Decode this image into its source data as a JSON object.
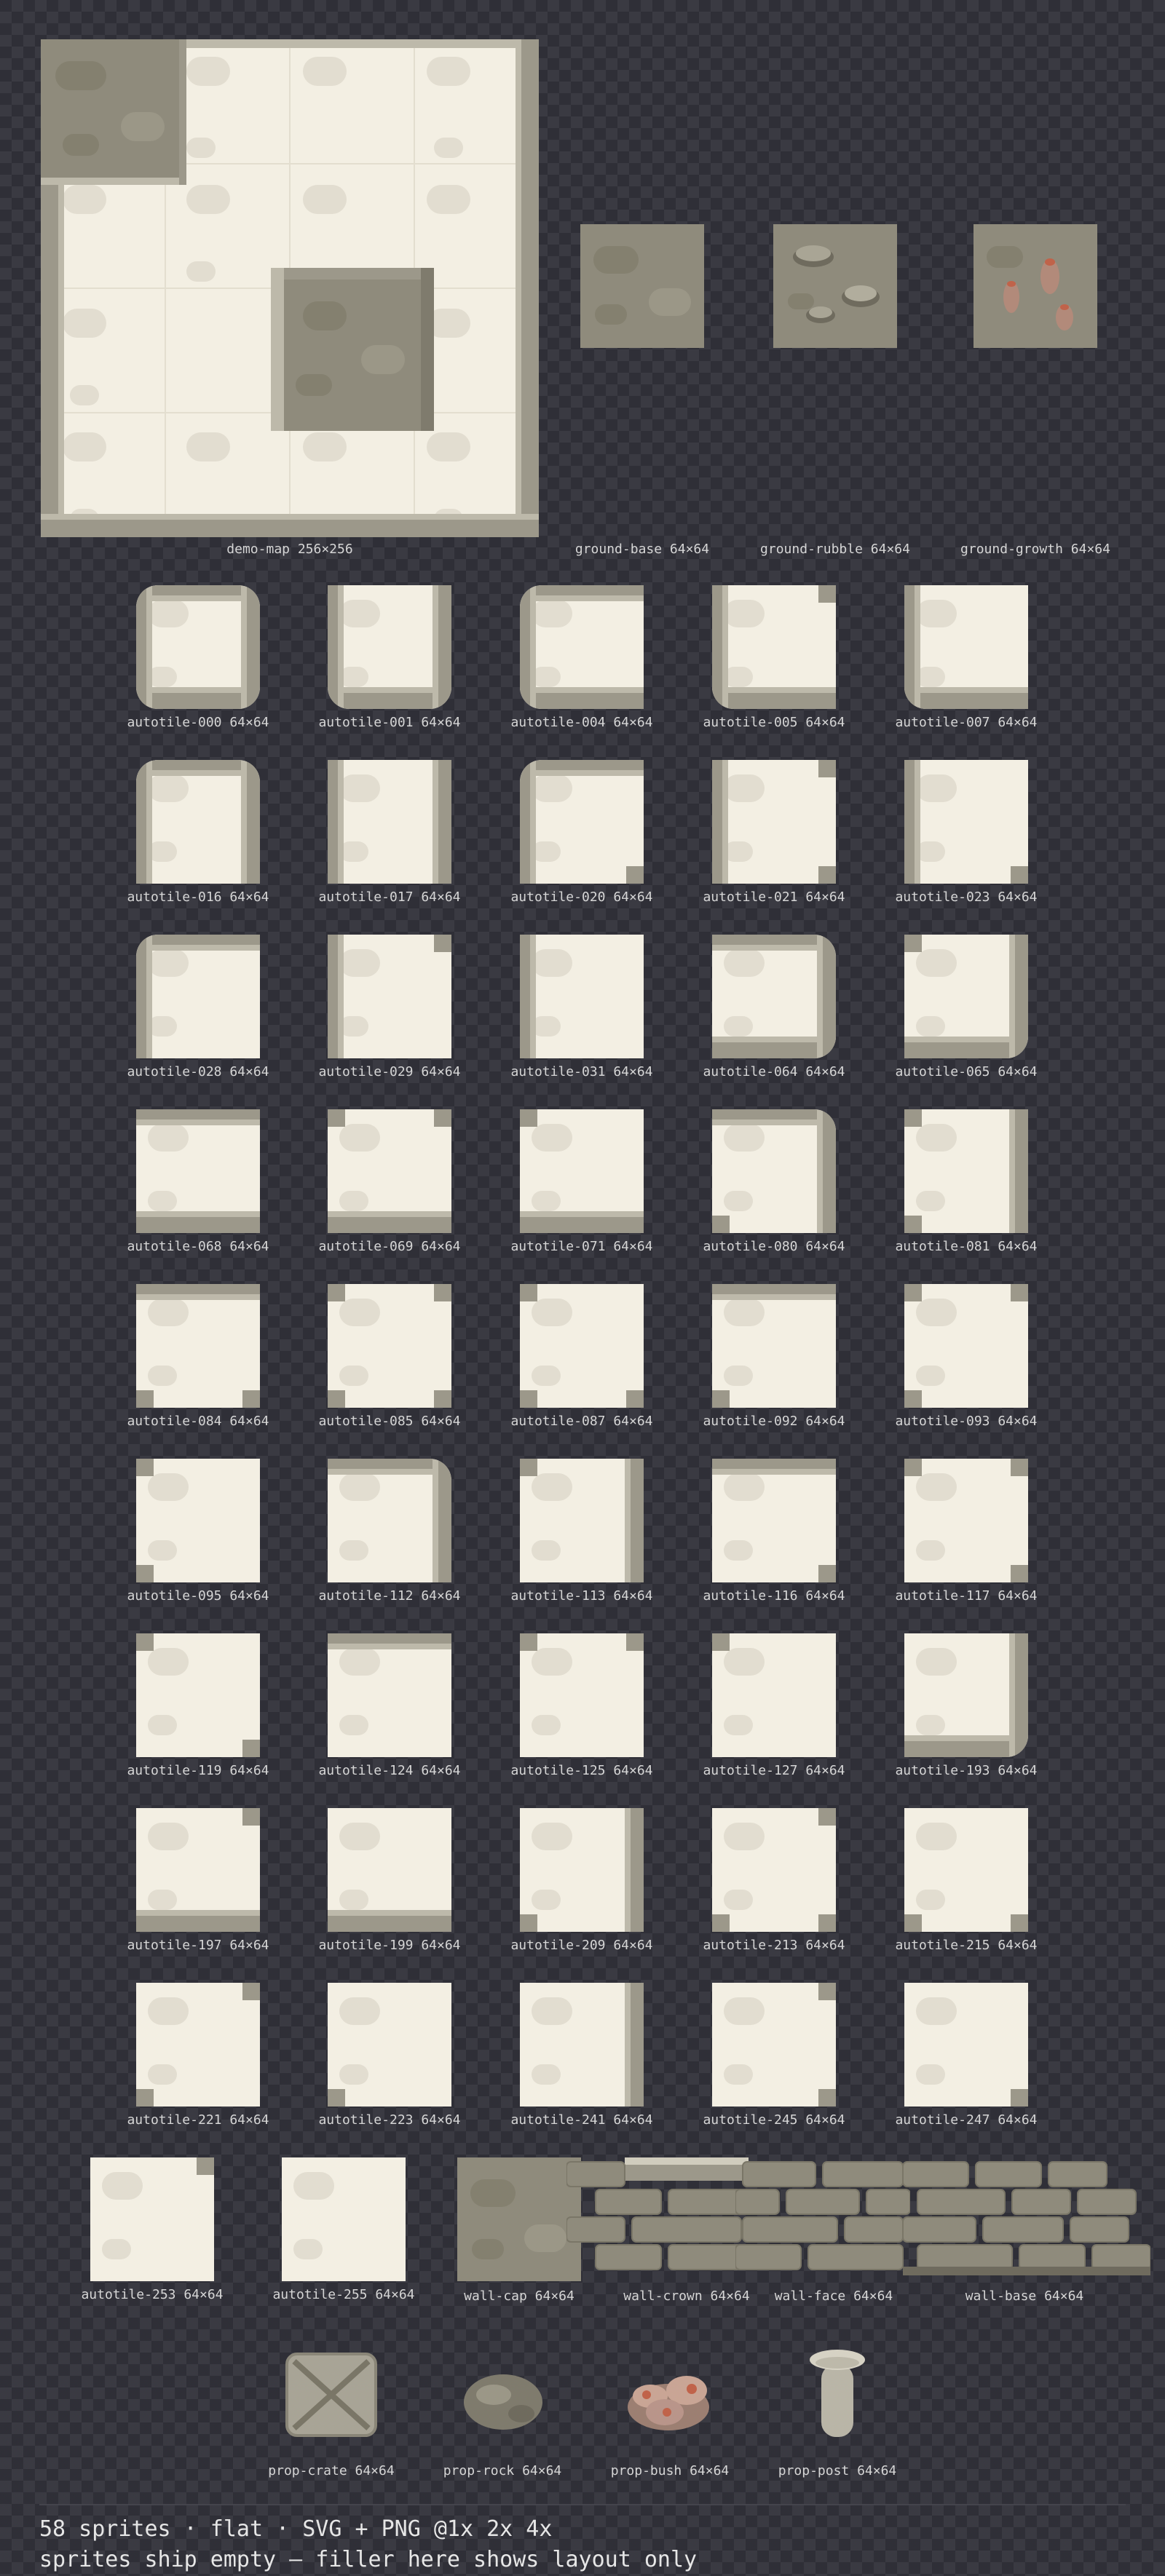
{
  "labels": {
    "demo_map": "demo-map 256×256",
    "ground_base": "ground-base 64×64",
    "ground_rubble": "ground-rubble 64×64",
    "ground_growth": "ground-growth 64×64",
    "wall_cap": "wall-cap 64×64",
    "wall_crown": "wall-crown 64×64",
    "wall_face": "wall-face 64×64",
    "wall_base": "wall-base 64×64",
    "prop_crate": "prop-crate 64×64",
    "prop_rock": "prop-rock 64×64",
    "prop_bush": "prop-bush 64×64",
    "prop_post": "prop-post 64×64"
  },
  "autotiles": [
    "autotile-000 64×64",
    "autotile-001 64×64",
    "autotile-004 64×64",
    "autotile-005 64×64",
    "autotile-007 64×64",
    "autotile-016 64×64",
    "autotile-017 64×64",
    "autotile-020 64×64",
    "autotile-021 64×64",
    "autotile-023 64×64",
    "autotile-028 64×64",
    "autotile-029 64×64",
    "autotile-031 64×64",
    "autotile-064 64×64",
    "autotile-065 64×64",
    "autotile-068 64×64",
    "autotile-069 64×64",
    "autotile-071 64×64",
    "autotile-080 64×64",
    "autotile-081 64×64",
    "autotile-084 64×64",
    "autotile-085 64×64",
    "autotile-087 64×64",
    "autotile-092 64×64",
    "autotile-093 64×64",
    "autotile-095 64×64",
    "autotile-112 64×64",
    "autotile-113 64×64",
    "autotile-116 64×64",
    "autotile-117 64×64",
    "autotile-119 64×64",
    "autotile-124 64×64",
    "autotile-125 64×64",
    "autotile-127 64×64",
    "autotile-193 64×64",
    "autotile-197 64×64",
    "autotile-199 64×64",
    "autotile-209 64×64",
    "autotile-213 64×64",
    "autotile-215 64×64",
    "autotile-221 64×64",
    "autotile-223 64×64",
    "autotile-241 64×64",
    "autotile-245 64×64",
    "autotile-247 64×64",
    "autotile-253 64×64",
    "autotile-255 64×64"
  ],
  "footer": {
    "line1": "58 sprites · flat · SVG + PNG @1x 2x 4x",
    "line2": "sprites ship empty — filler here shows layout only"
  },
  "colors": {
    "background": "#2f2f37",
    "floor": "#f3efe3",
    "wall": "#9c988a",
    "ground": "#8f8b7c",
    "accent": "#c0634a"
  }
}
